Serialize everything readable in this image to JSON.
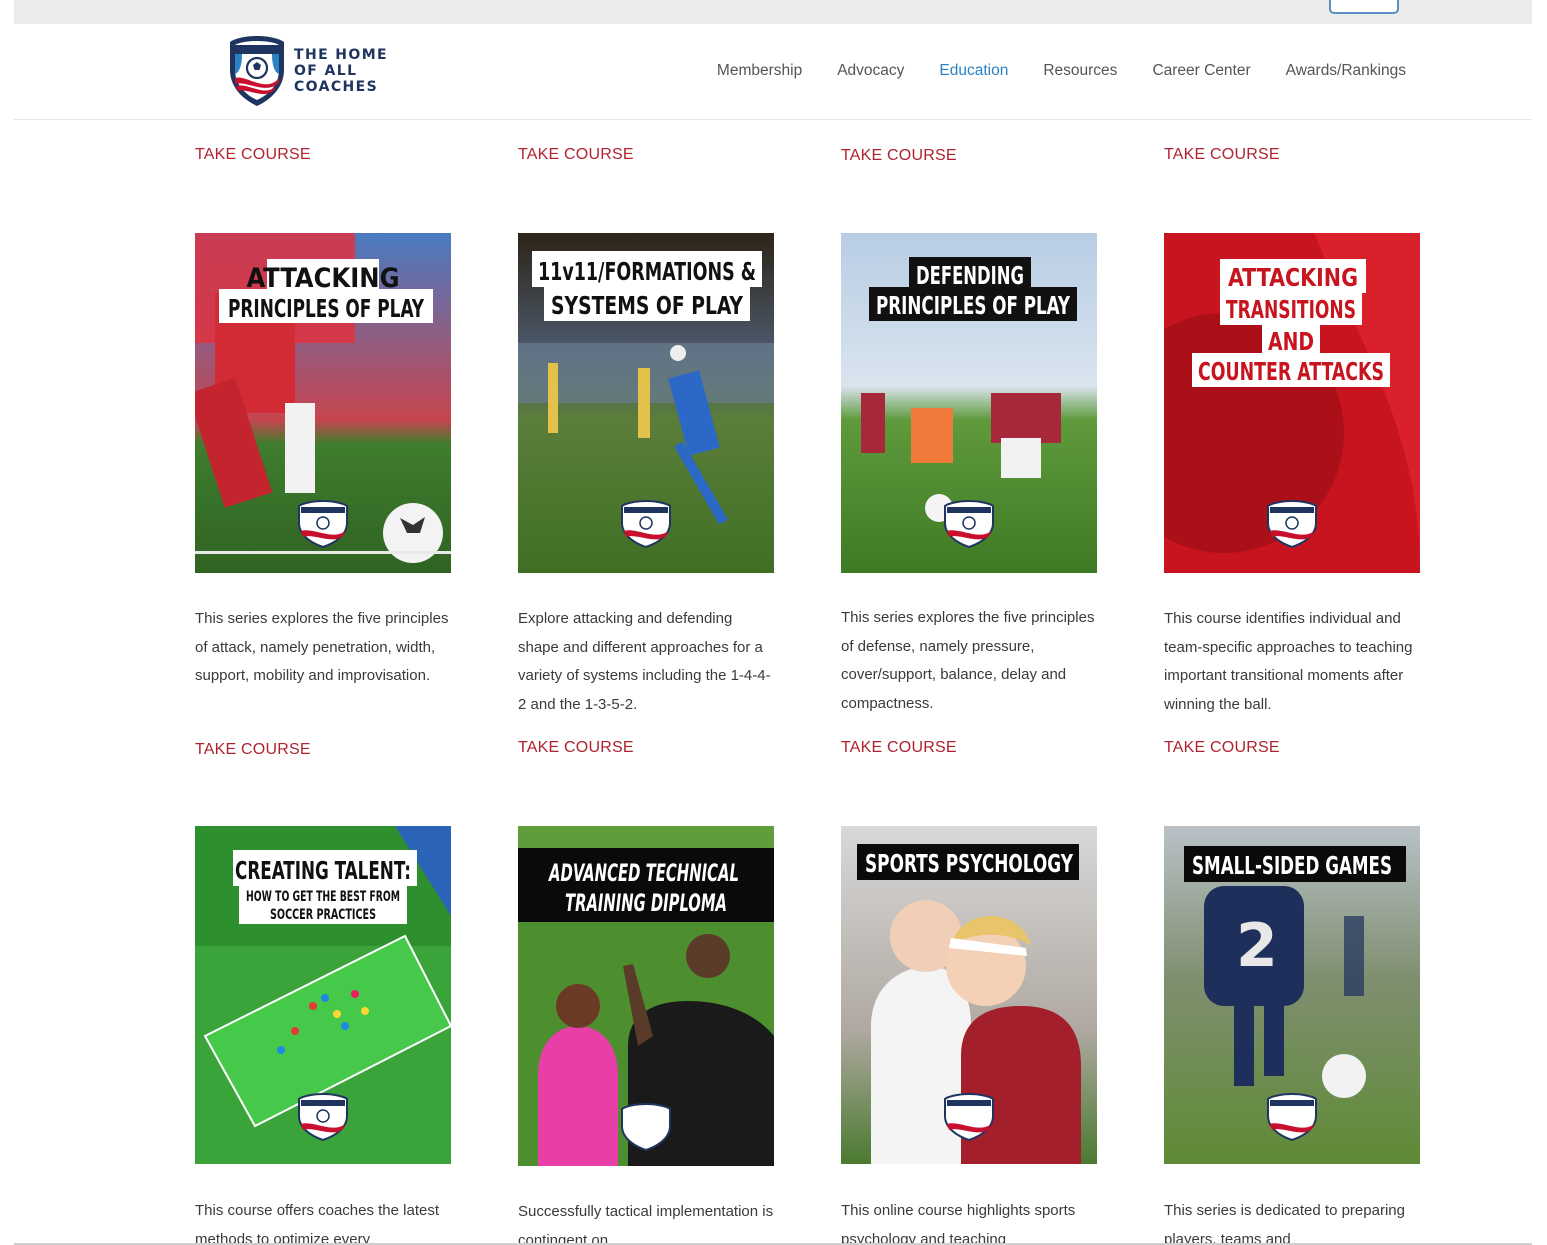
{
  "header": {
    "logo_lines": [
      "THE HOME",
      "OF ALL",
      "COACHES"
    ],
    "nav": [
      {
        "label": "Membership",
        "active": false
      },
      {
        "label": "Advocacy",
        "active": false
      },
      {
        "label": "Education",
        "active": true
      },
      {
        "label": "Resources",
        "active": false
      },
      {
        "label": "Career Center",
        "active": false
      },
      {
        "label": "Awards/Rankings",
        "active": false
      }
    ]
  },
  "top_row": {
    "take_label": "TAKE COURSE"
  },
  "courses": [
    {
      "title_lines": [
        "ATTACKING",
        "PRINCIPLES OF PLAY"
      ],
      "description": "This series explores the five principles of attack, namely penetration, width, support, mobility and improvisation.",
      "take_label": "TAKE COURSE"
    },
    {
      "title_lines": [
        "11v11/FORMATIONS &",
        "SYSTEMS OF PLAY"
      ],
      "description": "Explore attacking and defending shape and different approaches for a variety of systems including the 1-4-4-2 and the 1-3-5-2.",
      "take_label": "TAKE COURSE"
    },
    {
      "title_lines": [
        "DEFENDING",
        "PRINCIPLES OF PLAY"
      ],
      "description": "This series explores the five principles of defense, namely pressure, cover/support, balance, delay and compactness.",
      "take_label": "TAKE COURSE"
    },
    {
      "title_lines": [
        "ATTACKING",
        "TRANSITIONS",
        "AND",
        "COUNTER ATTACKS"
      ],
      "description": "This course identifies individual and team-specific approaches to teaching important transitional moments after winning the ball.",
      "take_label": "TAKE COURSE"
    },
    {
      "title_lines": [
        "CREATING TALENT:",
        "HOW TO GET THE BEST FROM",
        "SOCCER PRACTICES"
      ],
      "description": "This course offers coaches the latest methods to optimize every",
      "take_label": ""
    },
    {
      "title_lines": [
        "ADVANCED TECHNICAL",
        "TRAINING DIPLOMA"
      ],
      "description": "Successfully tactical implementation is contingent on",
      "take_label": ""
    },
    {
      "title_lines": [
        "SPORTS PSYCHOLOGY"
      ],
      "description": "This online course highlights sports psychology and teaching",
      "take_label": ""
    },
    {
      "title_lines": [
        "SMALL-SIDED GAMES"
      ],
      "description": "This series is dedicated to preparing players, teams and",
      "take_label": ""
    }
  ],
  "colors": {
    "accent_red": "#b0232f",
    "nav_active": "#2a82c4",
    "navy": "#1f3560"
  }
}
